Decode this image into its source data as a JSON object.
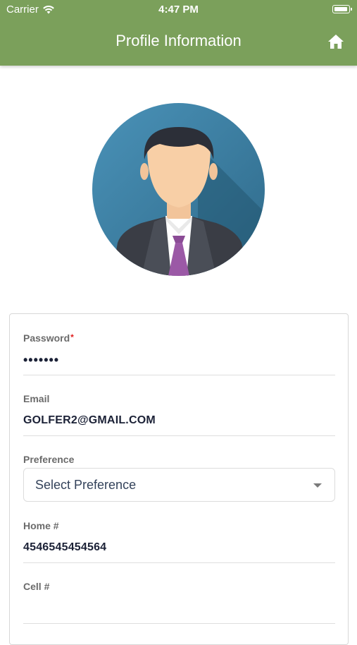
{
  "status_bar": {
    "carrier": "Carrier",
    "time": "4:47 PM",
    "wifi_icon": "wifi-icon",
    "battery_icon": "battery-icon"
  },
  "header": {
    "title": "Profile Information",
    "home_icon": "home-icon"
  },
  "avatar": {
    "icon": "user-avatar-icon"
  },
  "form": {
    "password": {
      "label": "Password",
      "required_mark": "*",
      "value": "•••••••"
    },
    "email": {
      "label": "Email",
      "value": "GOLFER2@GMAIL.COM"
    },
    "preference": {
      "label": "Preference",
      "placeholder": "Select Preference",
      "icon": "chevron-down-icon"
    },
    "home_phone": {
      "label": "Home #",
      "value": "4546545454564"
    },
    "cell_phone": {
      "label": "Cell #",
      "value": ""
    }
  },
  "colors": {
    "header": "#7ba05b",
    "header_text": "#ffffff",
    "value_text": "#1b2136",
    "label_text": "#6b6b6b",
    "required": "#e02020"
  }
}
